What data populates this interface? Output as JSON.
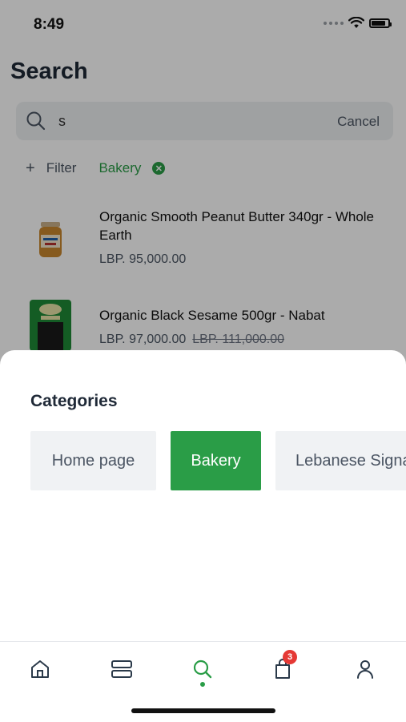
{
  "status_bar": {
    "time": "8:49"
  },
  "page": {
    "title": "Search",
    "search": {
      "value": "s",
      "cancel_label": "Cancel"
    },
    "filter_label": "Filter",
    "active_filter": "Bakery"
  },
  "products": [
    {
      "name": "Organic Smooth Peanut Butter 340gr - Whole Earth",
      "price": "LBP. 95,000.00",
      "old_price": ""
    },
    {
      "name": "Organic Black Sesame 500gr - Nabat",
      "price": "LBP. 97,000.00",
      "old_price": "LBP. 111,000.00"
    }
  ],
  "sheet": {
    "title": "Categories",
    "categories": [
      {
        "label": "Home page",
        "selected": false
      },
      {
        "label": "Bakery",
        "selected": true
      },
      {
        "label": "Lebanese Signature",
        "selected": false
      }
    ]
  },
  "tabbar": {
    "cart_badge": "3",
    "active_tab": "search",
    "accent_color": "#2a9d47",
    "tabs": [
      "home-icon",
      "categories-icon",
      "search-icon",
      "cart-icon",
      "profile-icon"
    ]
  }
}
